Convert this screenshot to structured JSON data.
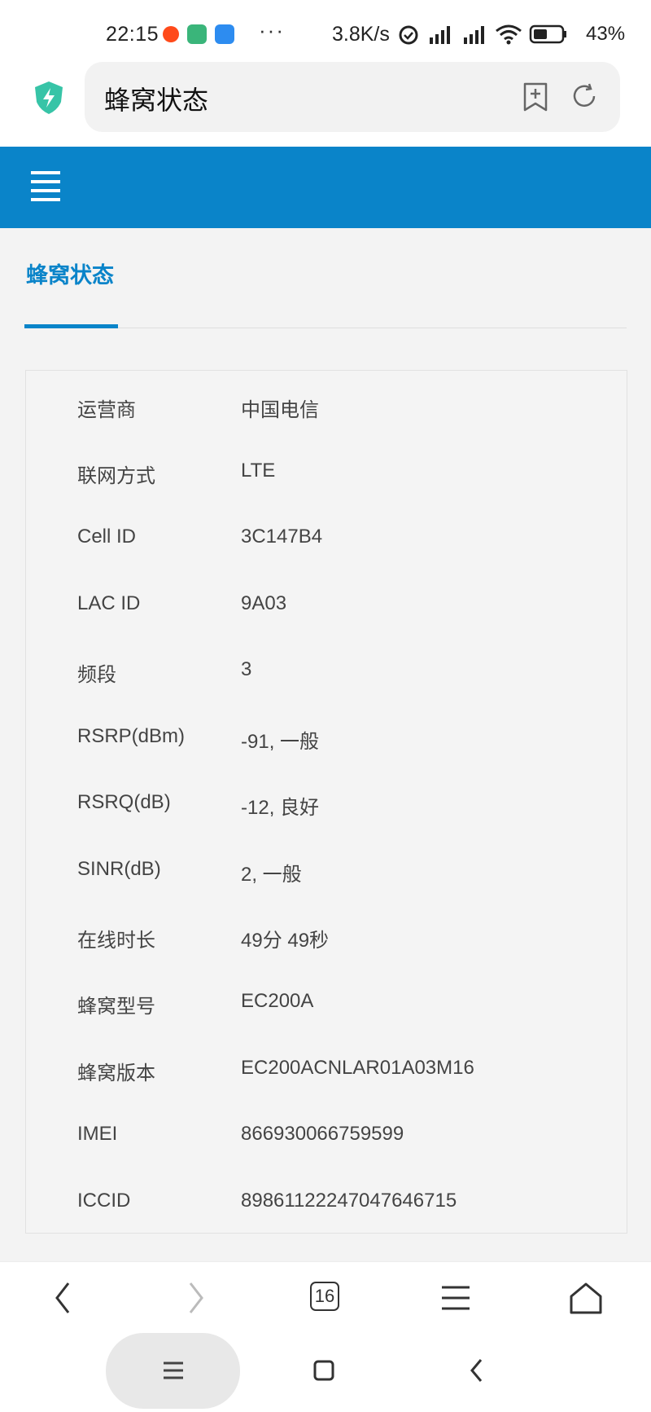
{
  "status_bar": {
    "time": "22:15",
    "more": "···",
    "network_speed": "3.8K/s",
    "battery_percent": "43%",
    "icons": [
      "notification-app-icon",
      "app-icon-green",
      "app-icon-blue",
      "alarm-icon",
      "signal-hd-icon",
      "signal-hd-icon",
      "wifi-icon",
      "battery-icon"
    ]
  },
  "address_bar": {
    "title": "蜂窝状态",
    "icons": [
      "shield-lightning-icon",
      "add-bookmark-icon",
      "reload-icon"
    ]
  },
  "header": {
    "menu_icon": "hamburger-icon",
    "accent_color": "#0a84c9"
  },
  "page": {
    "section_title": "蜂窝状态"
  },
  "info_rows": [
    {
      "label": "运营商",
      "value": "中国电信"
    },
    {
      "label": "联网方式",
      "value": "LTE"
    },
    {
      "label": "Cell ID",
      "value": "3C147B4"
    },
    {
      "label": "LAC ID",
      "value": "9A03"
    },
    {
      "label": "频段",
      "value": "3"
    },
    {
      "label": "RSRP(dBm)",
      "value": "-91, 一般"
    },
    {
      "label": "RSRQ(dB)",
      "value": "-12, 良好"
    },
    {
      "label": "SINR(dB)",
      "value": "2, 一般"
    },
    {
      "label": "在线时长",
      "value": "49分 49秒"
    },
    {
      "label": "蜂窝型号",
      "value": "EC200A"
    },
    {
      "label": "蜂窝版本",
      "value": "EC200ACNLAR01A03M16"
    },
    {
      "label": "IMEI",
      "value": "866930066759599"
    },
    {
      "label": "ICCID",
      "value": "89861122247047646715"
    }
  ],
  "browser_nav": {
    "tab_count": "16",
    "icons": [
      "back-icon",
      "forward-icon",
      "tabs-icon",
      "menu-icon",
      "home-icon"
    ]
  },
  "system_nav": {
    "icons": [
      "recents-icon",
      "home-square-icon",
      "back-chevron-icon"
    ]
  }
}
